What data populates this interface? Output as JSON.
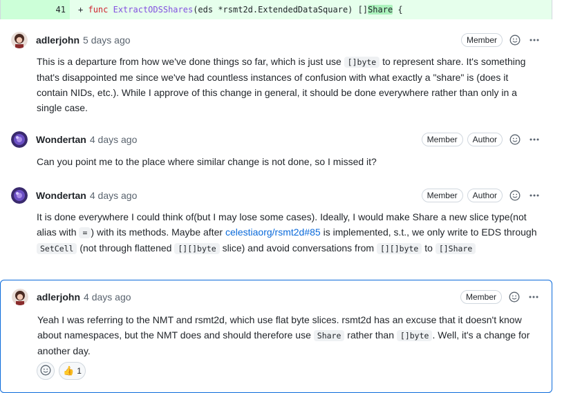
{
  "diff": {
    "line_number": "41",
    "prefix": "+",
    "kw": "func",
    "fn_name": "ExtractODSShares",
    "params": "(eds *rsmt2d.ExtendedDataSquare) []",
    "return_type": "Share",
    "tail": " {"
  },
  "comments": [
    {
      "author": "adlerjohn",
      "time": "5 days ago",
      "badges": [
        "Member"
      ],
      "segments": [
        "This is a departure from how we've done things so far, which is just use ",
        "[]byte",
        " to represent share. It's something that's disappointed me since we've had countless instances of confusion with what exactly a \"share\" is (does it contain NIDs, etc.). While I approve of this change in general, it should be done everywhere rather than only in a single case."
      ]
    },
    {
      "author": "Wondertan",
      "time": "4 days ago",
      "badges": [
        "Member",
        "Author"
      ],
      "segments": [
        "Can you point me to the place where similar change is not done, so I missed it?"
      ]
    },
    {
      "author": "Wondertan",
      "time": "4 days ago",
      "badges": [
        "Member",
        "Author"
      ],
      "segments": [
        "It is done everywhere I could think of(but I may lose some cases). Ideally, I would make Share a new slice type(not alias with ",
        "=",
        ") with its methods. Maybe after ",
        "celestiaorg/rsmt2d#85",
        " is implemented, s.t., we only write to EDS through ",
        "SetCell",
        " (not through flattened ",
        "[][]byte",
        " slice) and avoid conversations from ",
        "[][]byte",
        " to ",
        "[]Share"
      ]
    },
    {
      "author": "adlerjohn",
      "time": "4 days ago",
      "badges": [
        "Member"
      ],
      "segments": [
        "Yeah I was referring to the NMT and rsmt2d, which use flat byte slices. rsmt2d has an excuse that it doesn't know about namespaces, but the NMT does and should therefore use ",
        "Share",
        " rather than ",
        "[]byte",
        ". Well, it's a change for another day."
      ],
      "reactions": {
        "add_reaction_icon": "smiley-icon",
        "thumbs_up": {
          "emoji": "👍",
          "count": "1"
        }
      }
    }
  ],
  "icons": {
    "reaction": "smiley-icon",
    "menu": "kebab-horizontal-icon"
  },
  "colors": {
    "link": "#0969da",
    "selected_border": "#0969da",
    "diff_add_bg": "#e6ffec",
    "diff_gutter_bg": "#ccffd8"
  }
}
